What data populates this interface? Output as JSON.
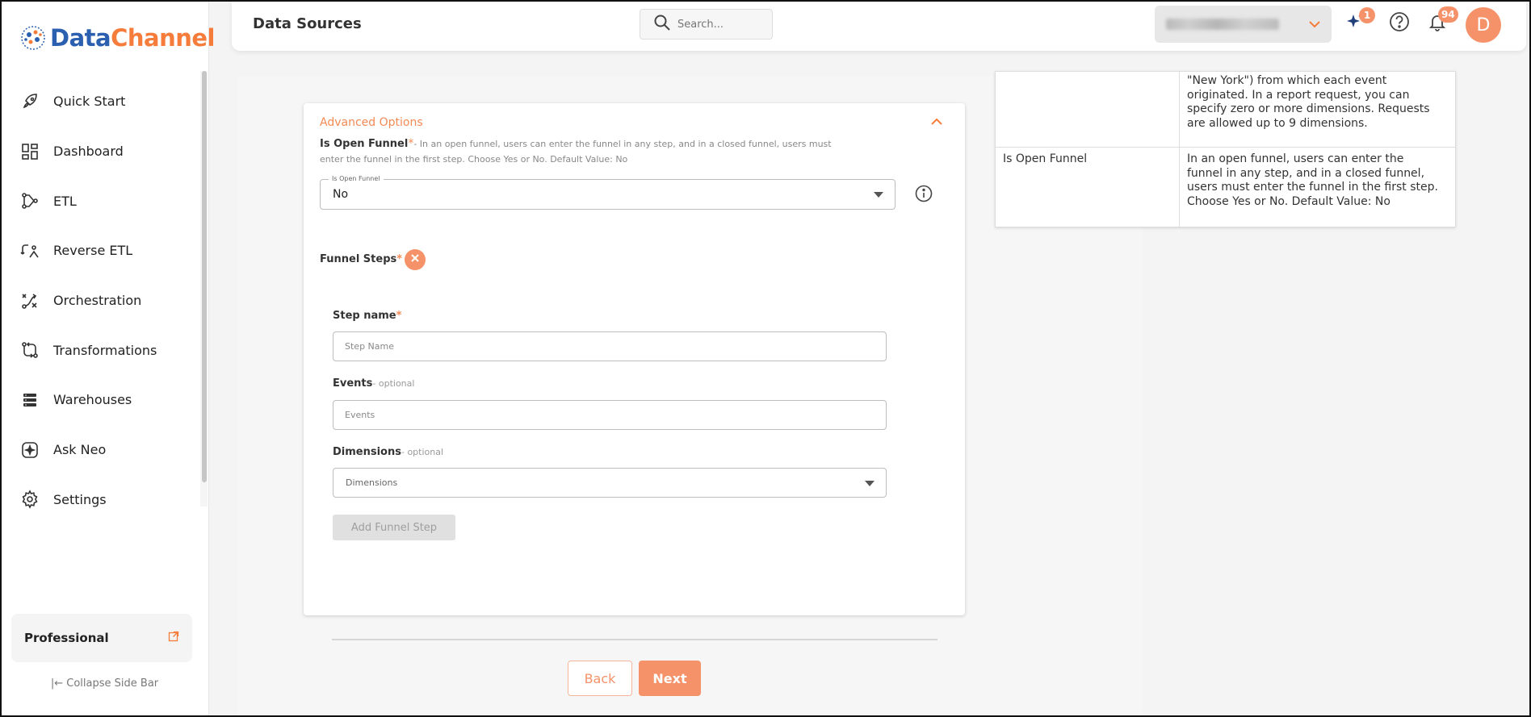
{
  "brand": {
    "name_part1": "Data",
    "name_part2": "Channel",
    "primary": "#2b5fb0",
    "accent": "#f57c3b"
  },
  "sidebar": {
    "items": [
      {
        "label": "Quick Start",
        "icon": "rocket-icon"
      },
      {
        "label": "Dashboard",
        "icon": "dashboard-icon"
      },
      {
        "label": "ETL",
        "icon": "etl-icon"
      },
      {
        "label": "Reverse ETL",
        "icon": "reverse-etl-icon"
      },
      {
        "label": "Orchestration",
        "icon": "orchestration-icon"
      },
      {
        "label": "Transformations",
        "icon": "transformations-icon"
      },
      {
        "label": "Warehouses",
        "icon": "warehouses-icon"
      },
      {
        "label": "Ask Neo",
        "icon": "ask-neo-icon"
      },
      {
        "label": "Settings",
        "icon": "gear-icon"
      }
    ],
    "plan": "Professional",
    "collapse_label": "Collapse Side Bar"
  },
  "header": {
    "title": "Data Sources",
    "search_placeholder": "Search...",
    "sparkle_badge": "1",
    "notification_badge": "94",
    "avatar_initial": "D"
  },
  "form": {
    "advanced_title": "Advanced Options",
    "open_funnel_label": "Is Open Funnel",
    "open_funnel_help": "- In an open funnel, users can enter the funnel in any step, and in a closed funnel, users must enter the funnel in the first step. Choose Yes or No. Default Value: No",
    "open_funnel_float_label": "Is Open Funnel",
    "open_funnel_value": "No",
    "funnel_steps_label": "Funnel Steps",
    "step_name_label": "Step name",
    "step_name_placeholder": "Step Name",
    "events_label": "Events",
    "events_optional": "- optional",
    "events_placeholder": "Events",
    "dimensions_label": "Dimensions",
    "dimensions_optional": "- optional",
    "dimensions_placeholder": "Dimensions",
    "add_step_label": "Add Funnel Step",
    "back_label": "Back",
    "next_label": "Next"
  },
  "help_table": {
    "row1_desc_lines": [
      "\"New York\") from which each event",
      "originated. In a report request, you can",
      "specify zero or more dimensions. Requests",
      "are allowed up to 9 dimensions."
    ],
    "row2_name": "Is Open Funnel",
    "row2_desc_lines": [
      "In an open funnel, users can enter the",
      "funnel in any step, and in a closed funnel,",
      "users must enter the funnel in the first step.",
      "Choose Yes or No. Default Value: No"
    ]
  }
}
